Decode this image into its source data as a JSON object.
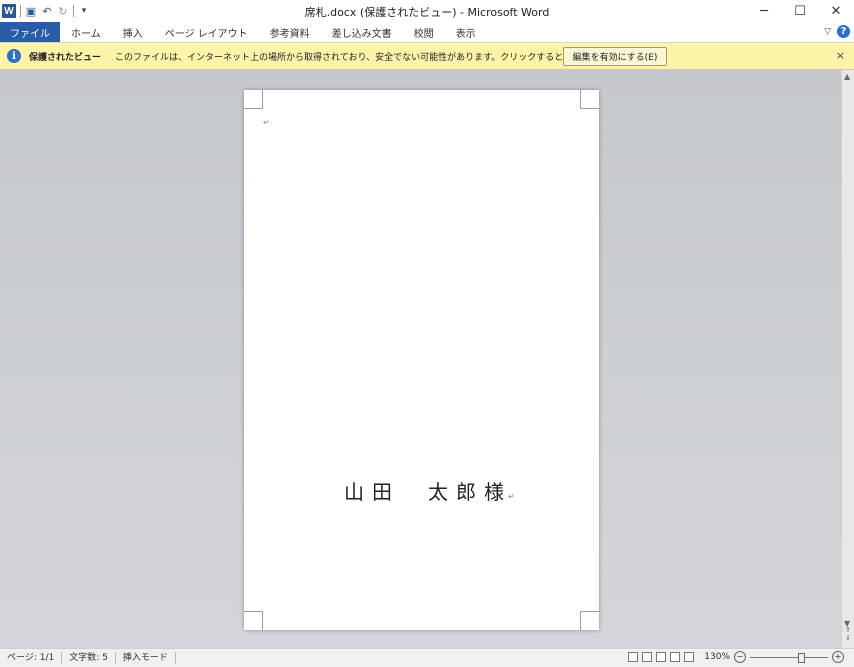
{
  "window": {
    "title": "席札.docx (保護されたビュー) - Microsoft Word",
    "app_icon_letter": "W",
    "min_glyph": "─",
    "max_glyph": "☐",
    "close_glyph": "✕"
  },
  "ribbon": {
    "tabs": [
      "ファイル",
      "ホーム",
      "挿入",
      "ページ レイアウト",
      "参考資料",
      "差し込み文書",
      "校閲",
      "表示"
    ],
    "help_glyph": "?"
  },
  "protected_view": {
    "title": "保護されたビュー",
    "message": "このファイルは、インターネット上の場所から取得されており、安全でない可能性があります。クリックすると詳細が表示されます。",
    "enable_button": "編集を有効にする(E)",
    "close_glyph": "×"
  },
  "document": {
    "paragraph_mark": "↵",
    "name_text": "山田　太郎様"
  },
  "status_bar": {
    "page": "ページ: 1/1",
    "word_count": "文字数: 5",
    "mode": "挿入モード",
    "zoom": "130%"
  },
  "colors": {
    "file_tab": "#2a5da8",
    "infobar": "#fdf3a9"
  }
}
